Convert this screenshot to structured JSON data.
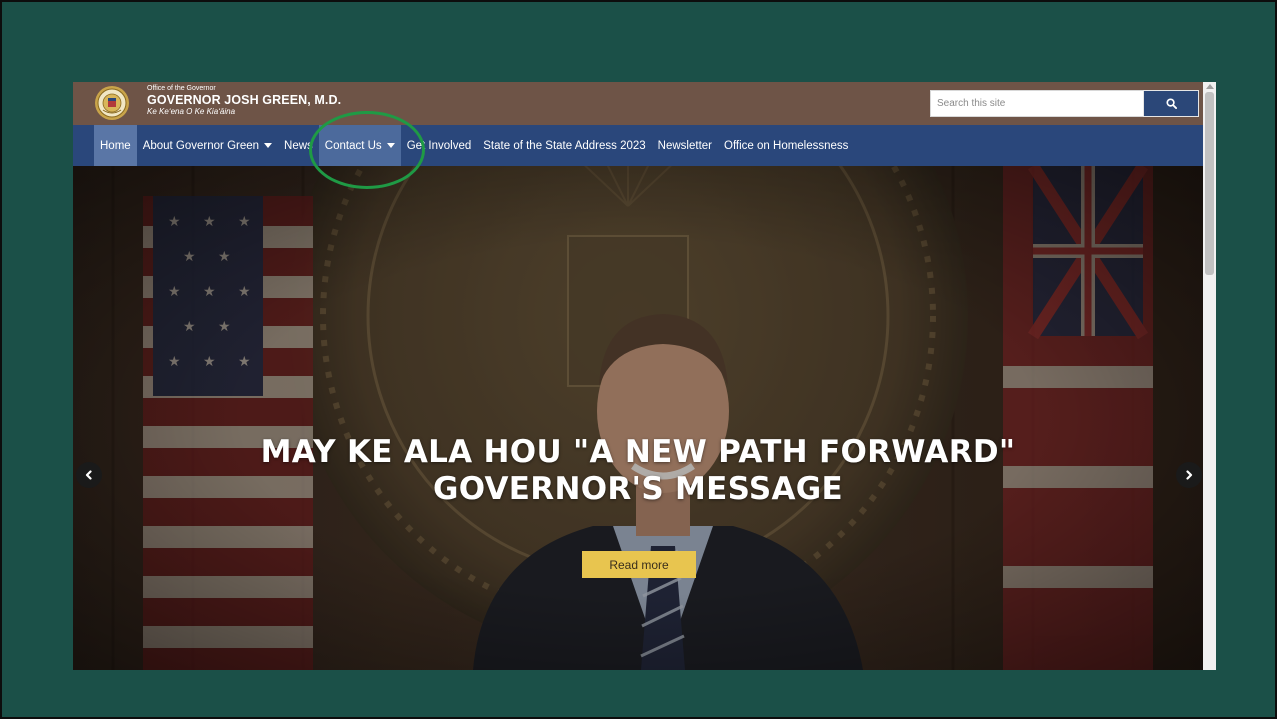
{
  "header": {
    "office_label": "Office of the Governor",
    "title": "GOVERNOR JOSH GREEN, M.D.",
    "subtitle": "Ke Keʻena O Ke Kiaʻāina",
    "logo_icon": "state-seal-icon"
  },
  "search": {
    "placeholder": "Search this site",
    "button_icon": "search-icon"
  },
  "nav": {
    "items": [
      {
        "label": "Home",
        "active": true
      },
      {
        "label": "About Governor Green",
        "has_dropdown": true
      },
      {
        "label": "News"
      },
      {
        "label": "Contact Us",
        "has_dropdown": true,
        "highlighted": true
      },
      {
        "label": "Get Involved"
      },
      {
        "label": "State of the State Address 2023"
      },
      {
        "label": "Newsletter"
      },
      {
        "label": "Office on Homelessness"
      }
    ]
  },
  "hero": {
    "title_line1": "MAY KE ALA HOU \"A NEW PATH FORWARD\"",
    "title_line2": "GOVERNOR'S MESSAGE",
    "button_label": "Read more",
    "prev_icon": "chevron-left-icon",
    "next_icon": "chevron-right-icon"
  },
  "colors": {
    "frame_bg": "#1b5048",
    "header_bg": "#6e5447",
    "nav_bg": "#2a477b",
    "highlight_circle": "#1f9a45",
    "button_bg": "#e8c54f"
  }
}
